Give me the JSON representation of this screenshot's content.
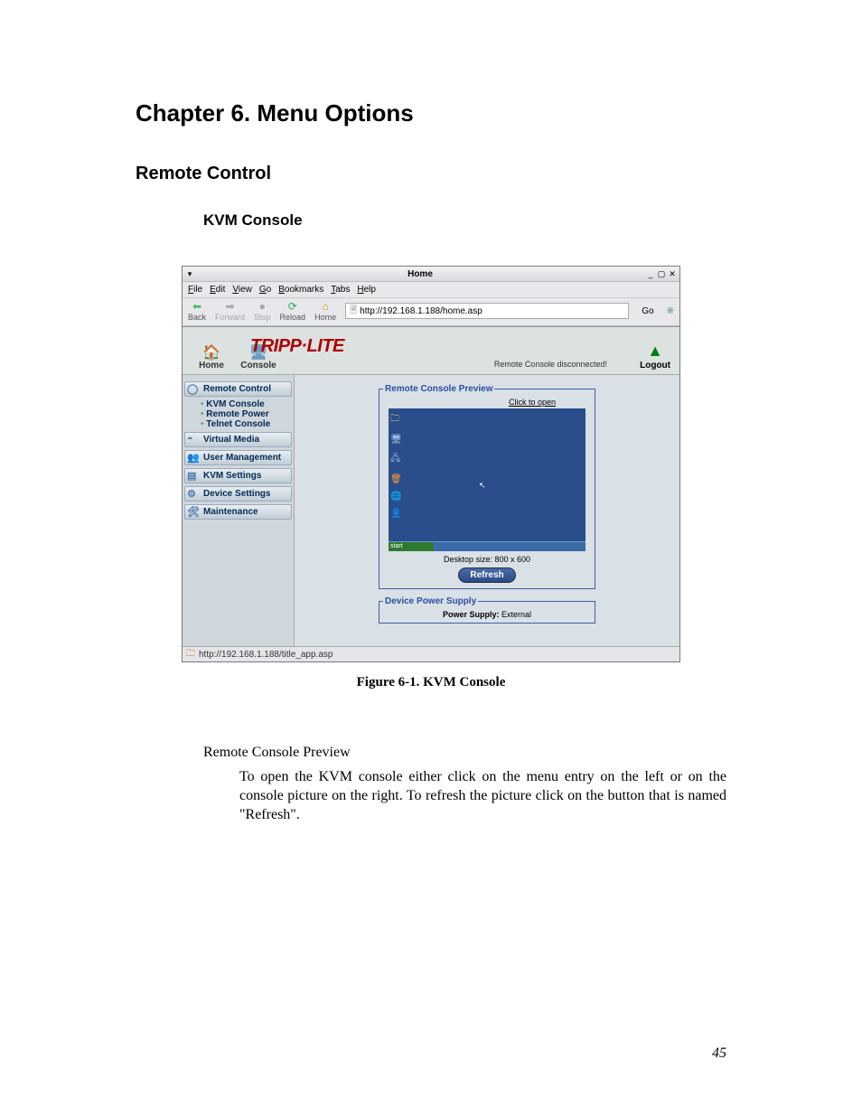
{
  "chapter_title": "Chapter 6. Menu Options",
  "section_title": "Remote Control",
  "subsection_title": "KVM Console",
  "figure_caption": "Figure 6-1. KVM Console",
  "body_label": "Remote Console Preview",
  "body_para": "To open the KVM console either click on the menu entry on the left or on the console picture on the right. To refresh the picture click on the button that is named \"Refresh\".",
  "page_number": "45",
  "browser": {
    "title": "Home",
    "menus": [
      "File",
      "Edit",
      "View",
      "Go",
      "Bookmarks",
      "Tabs",
      "Help"
    ],
    "tools": {
      "back": "Back",
      "forward": "Forward",
      "stop": "Stop",
      "reload": "Reload",
      "home": "Home"
    },
    "url": "http://192.168.1.188/home.asp",
    "go": "Go",
    "statusbar": "http://192.168.1.188/title_app.asp"
  },
  "app": {
    "logo": "TRIPP·LITE",
    "home": "Home",
    "console": "Console",
    "status": "Remote Console disconnected!",
    "logout": "Logout",
    "sidebar": {
      "remote_control": "Remote Control",
      "kvm_console": "KVM Console",
      "remote_power": "Remote Power",
      "telnet_console": "Telnet Console",
      "virtual_media": "Virtual Media",
      "user_management": "User Management",
      "kvm_settings": "KVM Settings",
      "device_settings": "Device Settings",
      "maintenance": "Maintenance"
    },
    "panel": {
      "preview_legend": "Remote Console Preview",
      "click_to_open": "Click to open",
      "desktop_size": "Desktop size: 800 x 600",
      "refresh": "Refresh",
      "power_legend": "Device Power Supply",
      "power_label": "Power Supply:",
      "power_value": "External",
      "start": "start"
    }
  }
}
